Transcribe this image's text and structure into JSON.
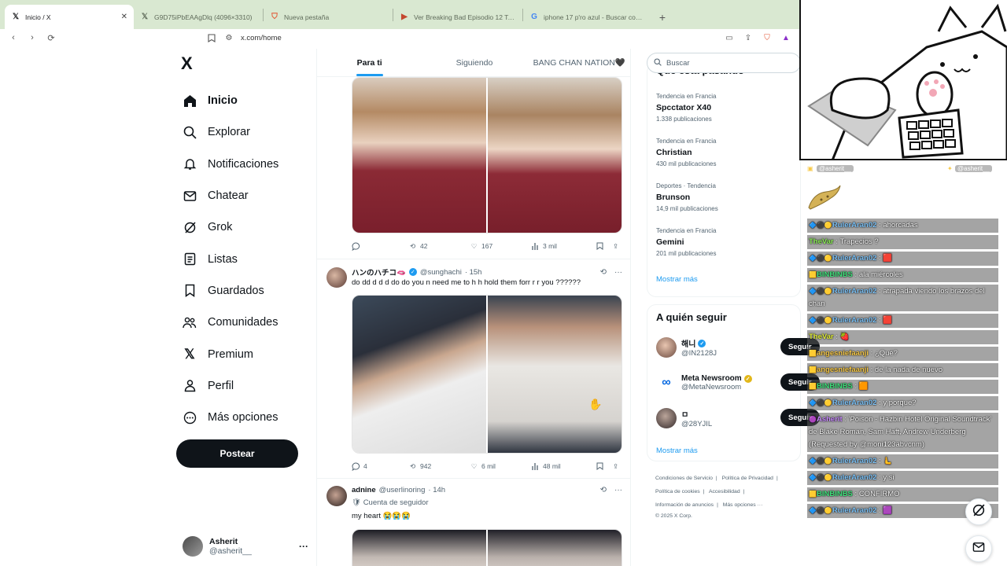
{
  "browser": {
    "tabs": [
      {
        "label": "Inicio / X",
        "icon": "x-logo-icon",
        "active": true
      },
      {
        "label": "G9D75iPbEAAgDlq (4096×3310)",
        "icon": "x-logo-icon",
        "active": false
      },
      {
        "label": "Nueva pestaña",
        "icon": "brave-icon",
        "active": false
      },
      {
        "label": "Ver Breaking Bad Episodio 12 Tempo",
        "icon": "video-icon",
        "active": false
      },
      {
        "label": "iphone 17 p'ro azul - Buscar con Goo",
        "icon": "google-icon",
        "active": false
      }
    ],
    "url": "x.com/home"
  },
  "sidebar": {
    "logo": "X",
    "items": [
      {
        "label": "Inicio",
        "icon": "home-icon",
        "active": true
      },
      {
        "label": "Explorar",
        "icon": "search-icon",
        "active": false
      },
      {
        "label": "Notificaciones",
        "icon": "bell-icon",
        "active": false
      },
      {
        "label": "Chatear",
        "icon": "mail-icon",
        "active": false
      },
      {
        "label": "Grok",
        "icon": "grok-icon",
        "active": false
      },
      {
        "label": "Listas",
        "icon": "list-icon",
        "active": false
      },
      {
        "label": "Guardados",
        "icon": "bookmark-icon",
        "active": false
      },
      {
        "label": "Comunidades",
        "icon": "people-icon",
        "active": false
      },
      {
        "label": "Premium",
        "icon": "x-logo-icon",
        "active": false
      },
      {
        "label": "Perfil",
        "icon": "person-icon",
        "active": false
      },
      {
        "label": "Más opciones",
        "icon": "more-circle-icon",
        "active": false
      }
    ],
    "post_label": "Postear",
    "profile": {
      "name": "Asherit",
      "handle": "@asherit__",
      "more": "···"
    }
  },
  "timeline": {
    "tabs": [
      "Para ti",
      "Siguiendo",
      "BANG CHAN NATION🖤"
    ],
    "posts": [
      {
        "name": "",
        "handle": "",
        "time": "",
        "text": "",
        "actions": {
          "replies": "",
          "reposts": "42",
          "likes": "167",
          "views": "3 mil"
        }
      },
      {
        "name": "ハンのハチコ🫦",
        "verified": true,
        "handle": "@sunghachi",
        "time": "· 15h",
        "text": "do dd d d d  do do you n need me to h h hold them forr r  r you ??????",
        "actions": {
          "replies": "4",
          "reposts": "942",
          "likes": "6 mil",
          "views": "48 mil"
        }
      },
      {
        "name": "adnine",
        "handle": "@userlinoring",
        "time": "· 14h",
        "subtitle": "🛡 Cuenta de seguidor",
        "text": "my heart 😭😭😭"
      }
    ]
  },
  "right": {
    "search_placeholder": "Buscar",
    "trends_header_partial": "Qué está pasando",
    "trends": [
      {
        "context": "Tendencia en Francia",
        "name": "Spcctator X40",
        "count": "1.338 publicaciones"
      },
      {
        "context": "Tendencia en Francia",
        "name": "Christian",
        "count": "430 mil publicaciones"
      },
      {
        "context": "Deportes · Tendencia",
        "name": "Brunson",
        "count": "14,9 mil publicaciones"
      },
      {
        "context": "Tendencia en Francia",
        "name": "Gemini",
        "count": "201 mil publicaciones"
      }
    ],
    "show_more": "Mostrar más",
    "who_to_follow_title": "A quién seguir",
    "who_to_follow": [
      {
        "name": "해니",
        "handle": "@IN2128J",
        "verified": true
      },
      {
        "name": "Meta Newsroom",
        "handle": "@MetaNewsroom",
        "verified": true
      },
      {
        "name": "ㅁ",
        "handle": "@28YJIL",
        "verified": false
      }
    ],
    "follow_label": "Seguir",
    "footer": [
      "Condiciones de Servicio",
      "Política de Privacidad",
      "Política de cookies",
      "Accesibilidad",
      "Información de anuncios",
      "Más opciones ···",
      "© 2025 X Corp."
    ]
  },
  "overlay": {
    "chat_tag_left": "@asherit__",
    "chat_tag_right": "@asherit__",
    "messages": [
      {
        "user": "RulerAran02",
        "color": "#7ec3f7",
        "badges": "🔷⚫🟡",
        "text": "ahorcadas"
      },
      {
        "user": "TheVar",
        "color": "#8ef05a",
        "badges": "",
        "text": "Trapecios ?"
      },
      {
        "user": "RulerAran02",
        "color": "#7ec3f7",
        "badges": "🔷⚫🟡",
        "text": "🟥"
      },
      {
        "user": "BINBINBS",
        "color": "#3ee07a",
        "badges": "🟨",
        "text": "ala miércoles"
      },
      {
        "user": "RulerAran02",
        "color": "#7ec3f7",
        "badges": "🔷⚫🟡",
        "text": "atrapada viendo los brazos del chan"
      },
      {
        "user": "RulerAran02",
        "color": "#7ec3f7",
        "badges": "🔷⚫🟡",
        "text": "🟥"
      },
      {
        "user": "TheVar",
        "color": "#e3f03a",
        "badges": "",
        "text": "🍓"
      },
      {
        "user": "angesniefaanji",
        "color": "#f7c948",
        "badges": "🟨",
        "text": "¿Qué?"
      },
      {
        "user": "angesniefaanji",
        "color": "#f7c948",
        "badges": "🟨",
        "text": "de la nada de nuevo"
      },
      {
        "user": "BINBINBS",
        "color": "#3ee07a",
        "badges": "🟨",
        "text": "🟧"
      },
      {
        "user": "RulerAran02",
        "color": "#7ec3f7",
        "badges": "🔷⚫🟡",
        "text": "y porque?"
      },
      {
        "user": "Asherit",
        "color": "#c98bff",
        "badges": "🟣",
        "text": "'Poison - Hazbin Hotel Original Soundtrack' de Blake Roman, Sam Haft, Andrew Underberg (Requested by @moni123abvcnm)"
      },
      {
        "user": "RulerAran02",
        "color": "#7ec3f7",
        "badges": "🔷⚫🟡",
        "text": "🫷"
      },
      {
        "user": "RulerAran02",
        "color": "#7ec3f7",
        "badges": "🔷⚫🟡",
        "text": "y si"
      },
      {
        "user": "BINBINBS",
        "color": "#3ee07a",
        "badges": "🟨",
        "text": "CONFIRMO"
      },
      {
        "user": "RulerAran02",
        "color": "#7ec3f7",
        "badges": "🔷⚫🟡",
        "text": "🟪"
      }
    ]
  },
  "colors": {
    "accent": "#1d9bf0",
    "text": "#0f1419",
    "muted": "#536471",
    "tabbar": "#d9e8d1"
  }
}
